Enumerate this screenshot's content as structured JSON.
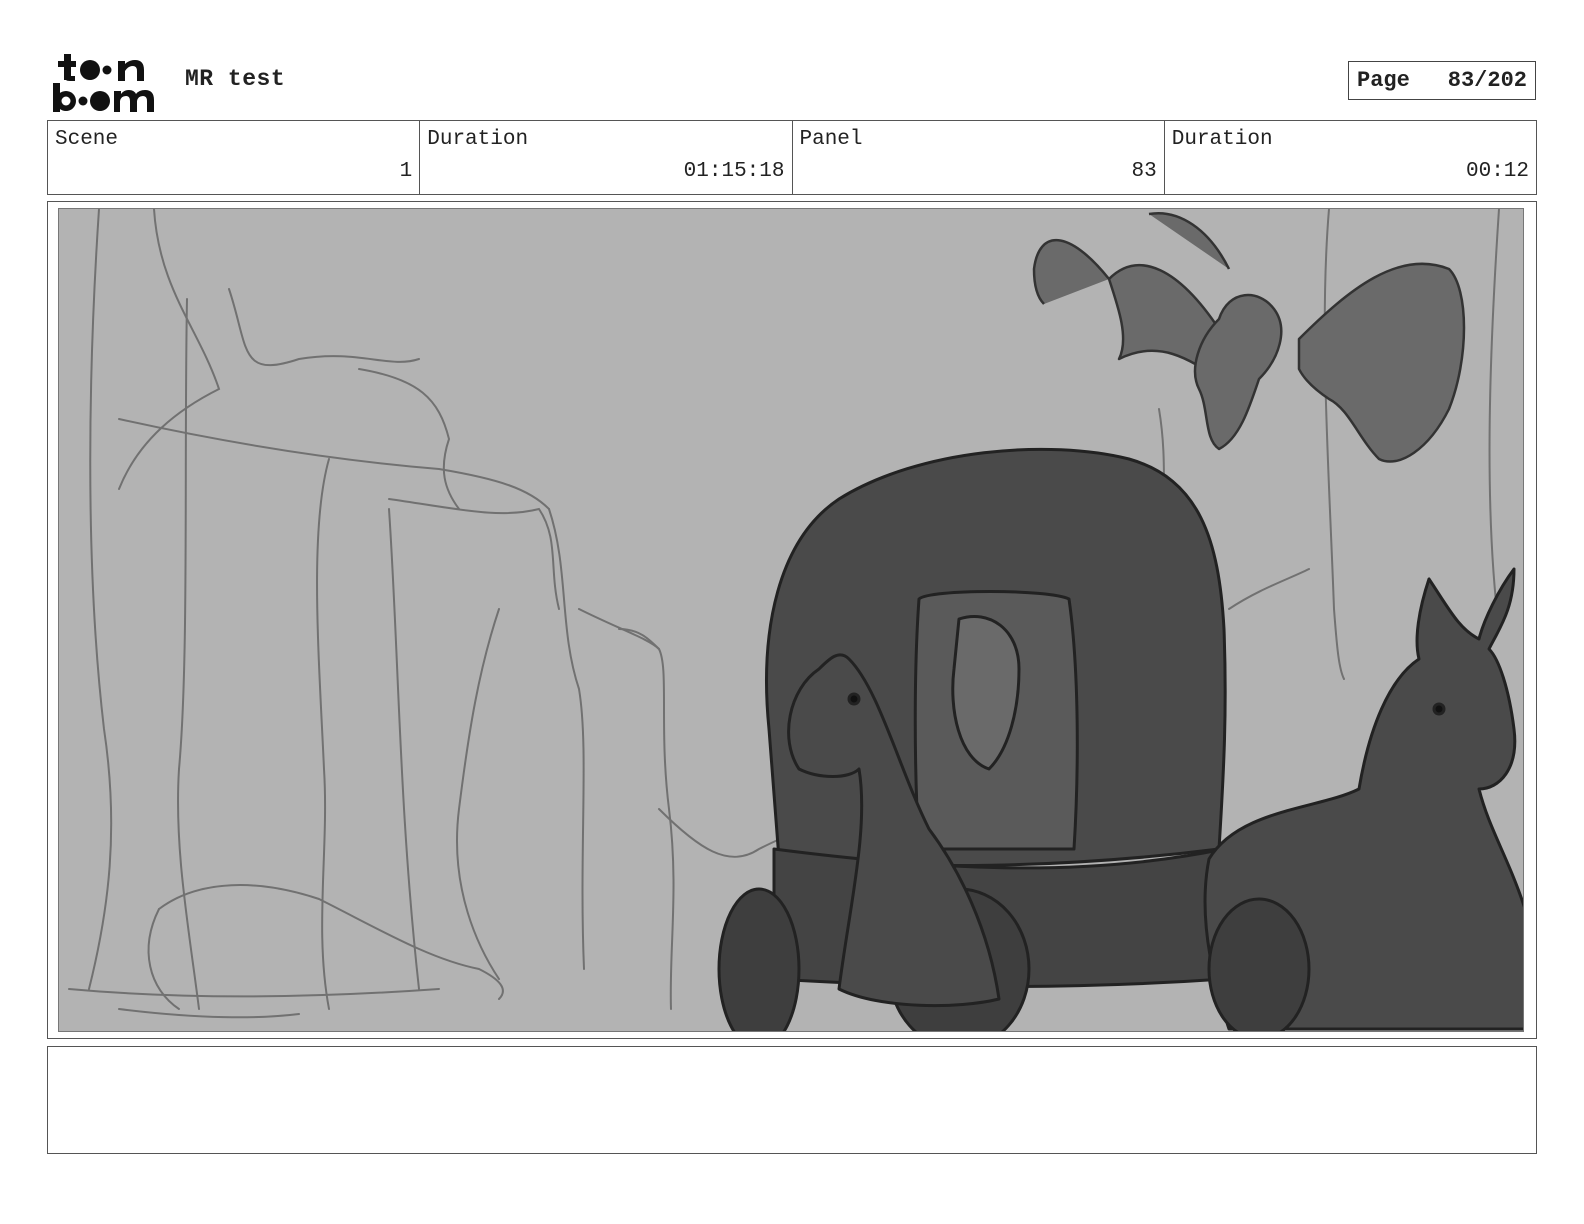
{
  "header": {
    "logo_alt": "toon boom",
    "project_title": "MR test",
    "page_label": "Page",
    "page_number": "83/202"
  },
  "info": [
    {
      "label": "Scene",
      "value": "1"
    },
    {
      "label": "Duration",
      "value": "01:15:18"
    },
    {
      "label": "Panel",
      "value": "83"
    },
    {
      "label": "Duration",
      "value": "00:12"
    }
  ],
  "panel": {
    "sketch_icon": "storyboard-sketch",
    "description": "",
    "background_color": "#b3b3b3",
    "ink_color": "#4a4a4a"
  },
  "notes": {
    "text": ""
  }
}
